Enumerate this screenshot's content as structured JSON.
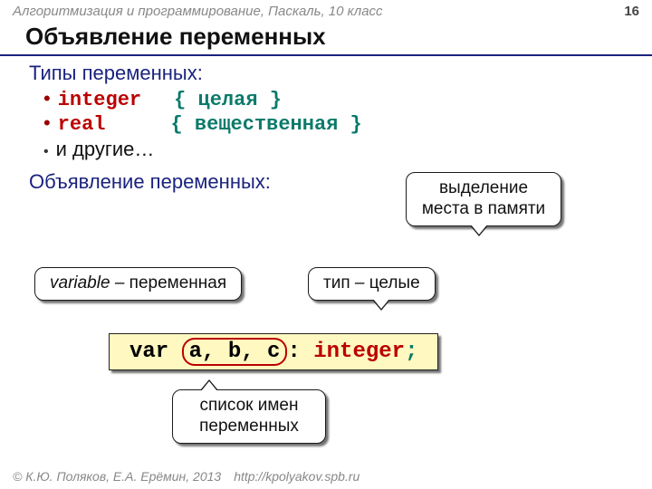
{
  "header": {
    "course": "Алгоритмизация и программирование, Паскаль, 10 класс",
    "page": "16"
  },
  "title": "Объявление переменных",
  "types": {
    "heading": "Типы переменных:",
    "items": [
      {
        "kw": "integer",
        "cmt": "{ целая }"
      },
      {
        "kw": "real",
        "cmt": "{ вещественная }"
      }
    ],
    "other": "и другие…"
  },
  "decl_heading": "Объявление переменных:",
  "callouts": {
    "memory": "выделение места в памяти",
    "variable_it": "variable",
    "variable_rest": " – переменная",
    "type": "тип – целые",
    "list": "список имен переменных"
  },
  "code": {
    "var": "var ",
    "ids": "a, b, c",
    "colon": ": ",
    "type": "integer",
    "semi": ";"
  },
  "footer": {
    "copyright": "© К.Ю. Поляков, Е.А. Ерёмин, 2013",
    "url": "http://kpolyakov.spb.ru"
  }
}
